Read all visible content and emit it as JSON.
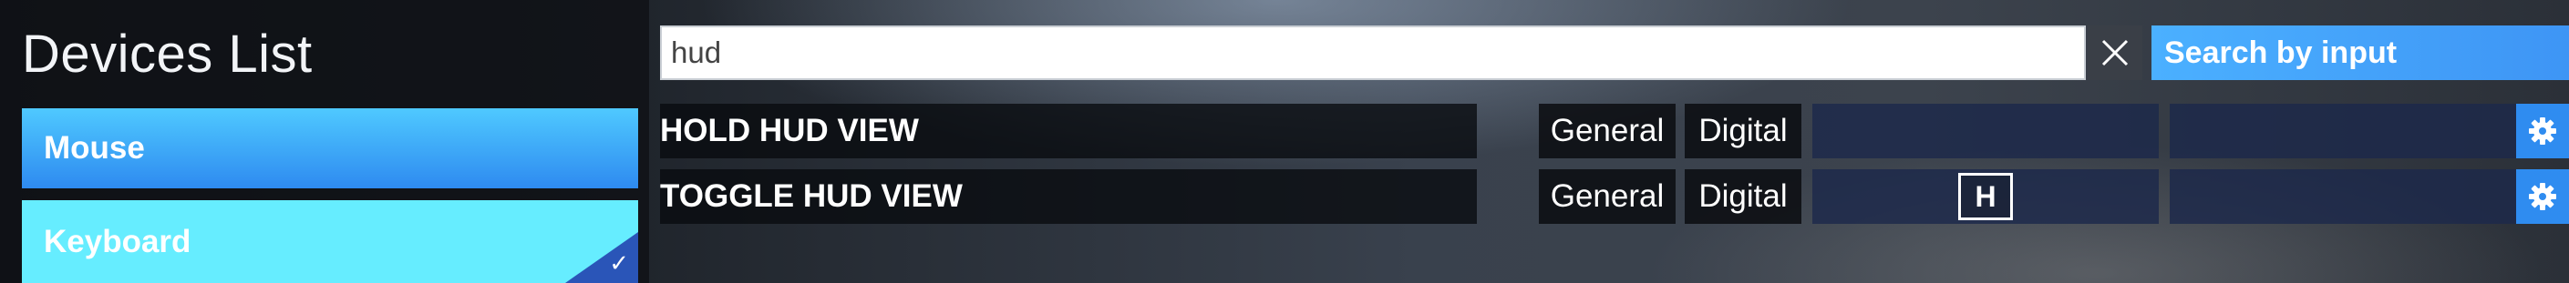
{
  "devices": {
    "title": "Devices List",
    "items": [
      {
        "label": "Mouse",
        "selected": false
      },
      {
        "label": "Keyboard",
        "selected": true
      }
    ]
  },
  "search": {
    "value": "hud",
    "mode_label": "Search by input"
  },
  "results": [
    {
      "action": "HOLD HUD VIEW",
      "category": "General",
      "type": "Digital",
      "binding_1": "",
      "binding_2": ""
    },
    {
      "action": "TOGGLE HUD VIEW",
      "category": "General",
      "type": "Digital",
      "binding_1": "H",
      "binding_2": ""
    }
  ],
  "icons": {
    "clear": "close-icon",
    "settings": "gear-icon",
    "selected": "checkmark-icon"
  },
  "colors": {
    "accent_blue": "#3e95f5",
    "keyboard_cyan": "#66edff",
    "checkmark_corner": "#2a55b8"
  }
}
